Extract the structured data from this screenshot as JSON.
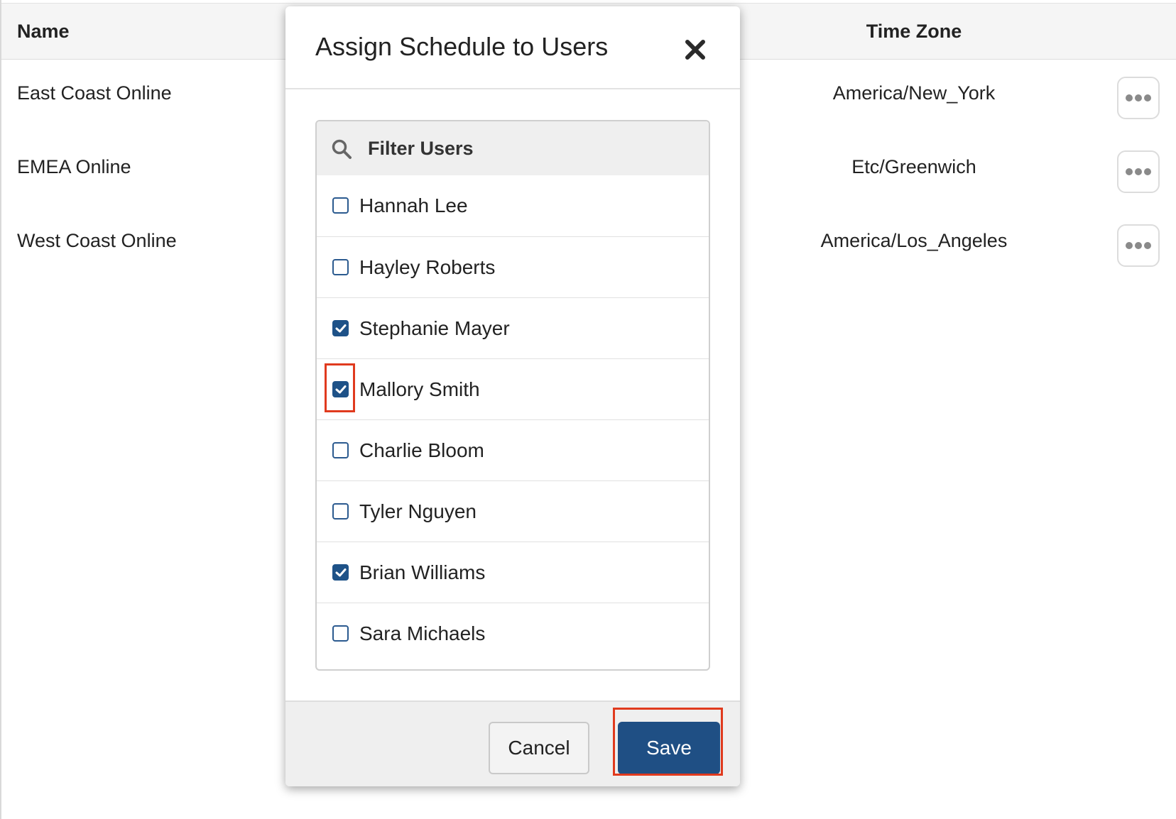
{
  "table": {
    "headers": {
      "name": "Name",
      "time_zone": "Time Zone"
    },
    "rows": [
      {
        "name": "East Coast Online",
        "time_zone": "America/New_York"
      },
      {
        "name": "EMEA Online",
        "time_zone": "Etc/Greenwich"
      },
      {
        "name": "West Coast Online",
        "time_zone": "America/Los_Angeles"
      }
    ],
    "row_action_icon": "more-horizontal-icon"
  },
  "modal": {
    "title": "Assign Schedule to Users",
    "close_icon": "close-icon",
    "filter": {
      "placeholder": "Filter Users",
      "value": "",
      "icon": "search-icon"
    },
    "users": [
      {
        "name": "Hannah Lee",
        "checked": false
      },
      {
        "name": "Hayley Roberts",
        "checked": false
      },
      {
        "name": "Stephanie Mayer",
        "checked": true
      },
      {
        "name": "Mallory Smith",
        "checked": true
      },
      {
        "name": "Charlie Bloom",
        "checked": false
      },
      {
        "name": "Tyler Nguyen",
        "checked": false
      },
      {
        "name": "Brian Williams",
        "checked": true
      },
      {
        "name": "Sara Michaels",
        "checked": false
      }
    ],
    "buttons": {
      "cancel": "Cancel",
      "save": "Save"
    }
  },
  "colors": {
    "primary": "#1f4f84",
    "highlight": "#e03a1e"
  }
}
